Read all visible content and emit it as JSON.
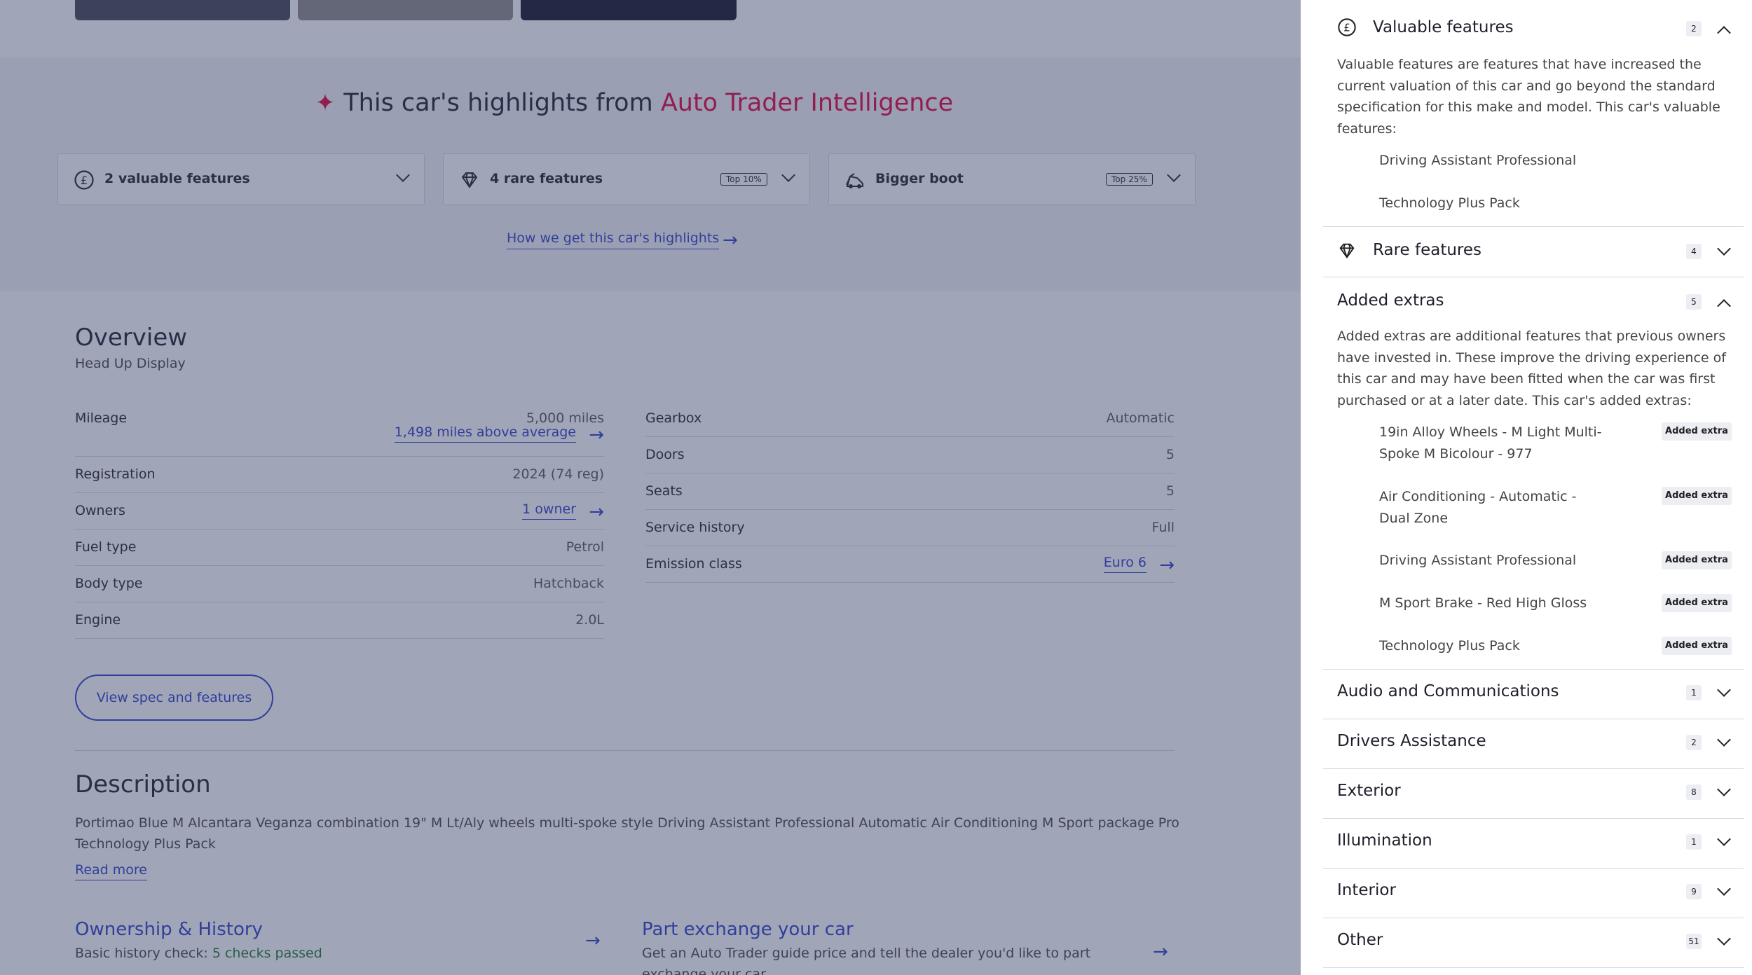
{
  "highlights": {
    "title_prefix": "This car's highlights from",
    "title_brand": "Auto Trader Intelligence",
    "cards": [
      {
        "label": "2 valuable features",
        "icon": "pound-coin-icon",
        "badge": ""
      },
      {
        "label": "4 rare features",
        "icon": "diamond-icon",
        "badge": "Top 10%"
      },
      {
        "label": "Bigger boot",
        "icon": "boot-icon",
        "badge": "Top 25%"
      }
    ],
    "how_link": "How we get this car's highlights"
  },
  "overview": {
    "title": "Overview",
    "subtitle": "Head Up Display",
    "left": [
      {
        "key": "Mileage",
        "value": "5,000 miles",
        "link": "1,498 miles above average"
      },
      {
        "key": "Registration",
        "value": "2024 (74 reg)"
      },
      {
        "key": "Owners",
        "link": "1 owner"
      },
      {
        "key": "Fuel type",
        "value": "Petrol"
      },
      {
        "key": "Body type",
        "value": "Hatchback"
      },
      {
        "key": "Engine",
        "value": "2.0L"
      }
    ],
    "right": [
      {
        "key": "Gearbox",
        "value": "Automatic"
      },
      {
        "key": "Doors",
        "value": "5"
      },
      {
        "key": "Seats",
        "value": "5"
      },
      {
        "key": "Service history",
        "value": "Full"
      },
      {
        "key": "Emission class",
        "link": "Euro 6"
      }
    ],
    "spec_button": "View spec and features"
  },
  "description": {
    "title": "Description",
    "text": "Portimao Blue M Alcantara Veganza combination 19\" M Lt/Aly wheels multi-spoke style Driving Assistant Professional Automatic Air Conditioning M Sport package Pro Technology Plus Pack",
    "read_more": "Read more"
  },
  "ownership": {
    "title": "Ownership & History",
    "text_prefix": "Basic history check:",
    "checks": "5 checks passed"
  },
  "part_exchange": {
    "title": "Part exchange your car",
    "text": "Get an Auto Trader guide price and tell the dealer you'd like to part exchange your car"
  },
  "panel": {
    "valuable": {
      "title": "Valuable features",
      "count": "2",
      "intro": "Valuable features are features that have increased the current valuation of this car and go beyond the standard specification for this make and model. This car's valuable features:",
      "items": [
        "Driving Assistant Professional",
        "Technology Plus Pack"
      ]
    },
    "rare": {
      "title": "Rare features",
      "count": "4"
    },
    "extras": {
      "title": "Added extras",
      "count": "5",
      "intro": "Added extras are additional features that previous owners have invested in. These improve the driving experience of this car and may have been fitted when the car was first purchased or at a later date. This car's added extras:",
      "badge_label": "Added extra",
      "items": [
        "19in Alloy Wheels - M Light Multi-Spoke M Bicolour - 977",
        "Air Conditioning - Automatic - Dual Zone",
        "Driving Assistant Professional",
        "M Sport Brake - Red High Gloss",
        "Technology Plus Pack"
      ]
    },
    "categories": [
      {
        "title": "Audio and Communications",
        "count": "1"
      },
      {
        "title": "Drivers Assistance",
        "count": "2"
      },
      {
        "title": "Exterior",
        "count": "8"
      },
      {
        "title": "Illumination",
        "count": "1"
      },
      {
        "title": "Interior",
        "count": "9"
      },
      {
        "title": "Other",
        "count": "51"
      }
    ]
  },
  "colors": {
    "accent": "#2a3fc6",
    "brand": "#e2003c",
    "overlay": "rgba(55,64,104,0.47)"
  }
}
